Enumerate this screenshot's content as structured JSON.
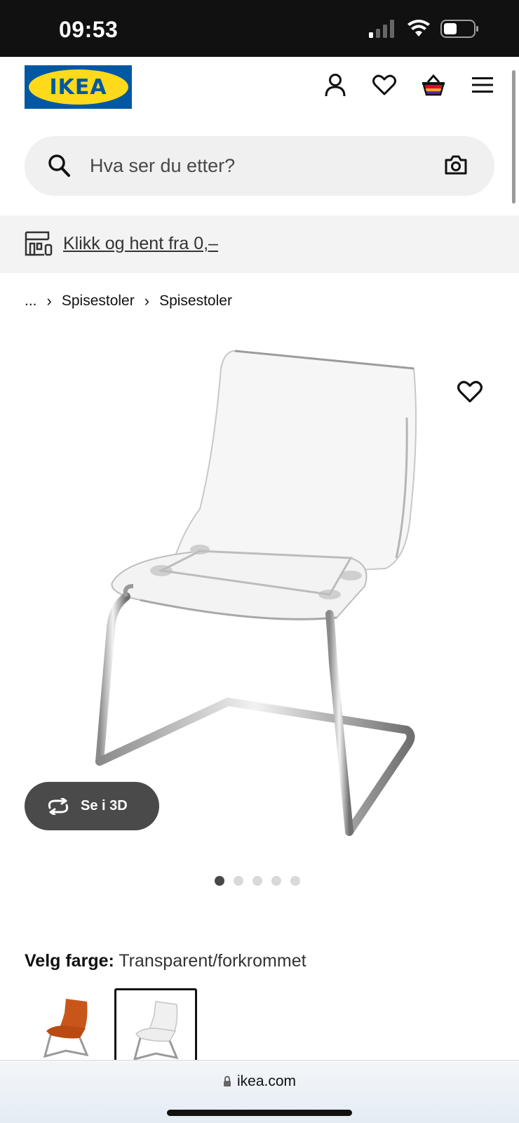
{
  "status": {
    "time": "09:53"
  },
  "header": {
    "logo_text": "IKEA",
    "brand_blue": "#0058a3",
    "brand_yellow": "#ffda1a",
    "icons": [
      "user-icon",
      "heart-icon",
      "basket-icon",
      "menu-icon"
    ]
  },
  "search": {
    "placeholder": "Hva ser du etter?"
  },
  "promo": {
    "link_text": "Klikk og hent fra 0,–"
  },
  "breadcrumb": {
    "ellipsis": "...",
    "items": [
      "Spisestoler",
      "Spisestoler"
    ]
  },
  "gallery": {
    "view_3d_label": "Se i 3D",
    "dot_count": 5,
    "active_dot": 1
  },
  "color_picker": {
    "label": "Velg farge:",
    "value": "Transparent/forkrommet",
    "swatches": [
      "orange-chair",
      "transparent-chair"
    ],
    "selected_swatch": 2
  },
  "browser": {
    "url": "ikea.com"
  }
}
